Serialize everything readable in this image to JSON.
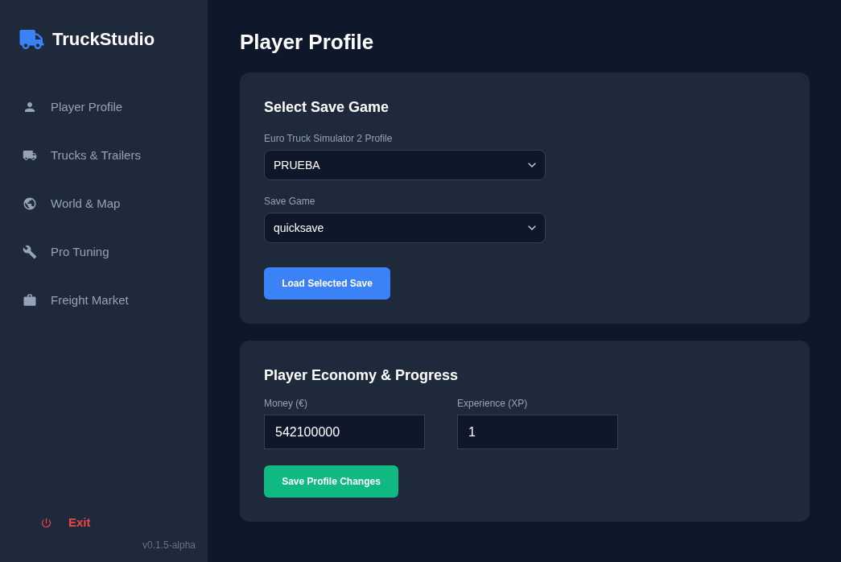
{
  "sidebar": {
    "app_name": "TruckStudio",
    "items": [
      {
        "label": "Player Profile",
        "selected": false
      },
      {
        "label": "Trucks & Trailers",
        "selected": false
      },
      {
        "label": "World & Map",
        "selected": false
      },
      {
        "label": "Pro Tuning",
        "selected": false
      },
      {
        "label": "Freight Market",
        "selected": false
      }
    ],
    "exit": "Exit",
    "version": "v0.1.5-alpha"
  },
  "page_title": "Player Profile",
  "save_game_card": {
    "title": "Select Save Game",
    "selects": [
      {
        "label": "Euro Truck Simulator 2 Profile",
        "value": "PRUEBA"
      },
      {
        "label": "Save Game",
        "value": "quicksave"
      }
    ],
    "button": "Load Selected Save"
  },
  "economy_card": {
    "title": "Player Economy & Progress",
    "fields": [
      {
        "label": "Money (€)",
        "value": "542100000"
      },
      {
        "label": "Experience (XP)",
        "value": "1"
      }
    ],
    "button": "Save Profile Changes"
  }
}
